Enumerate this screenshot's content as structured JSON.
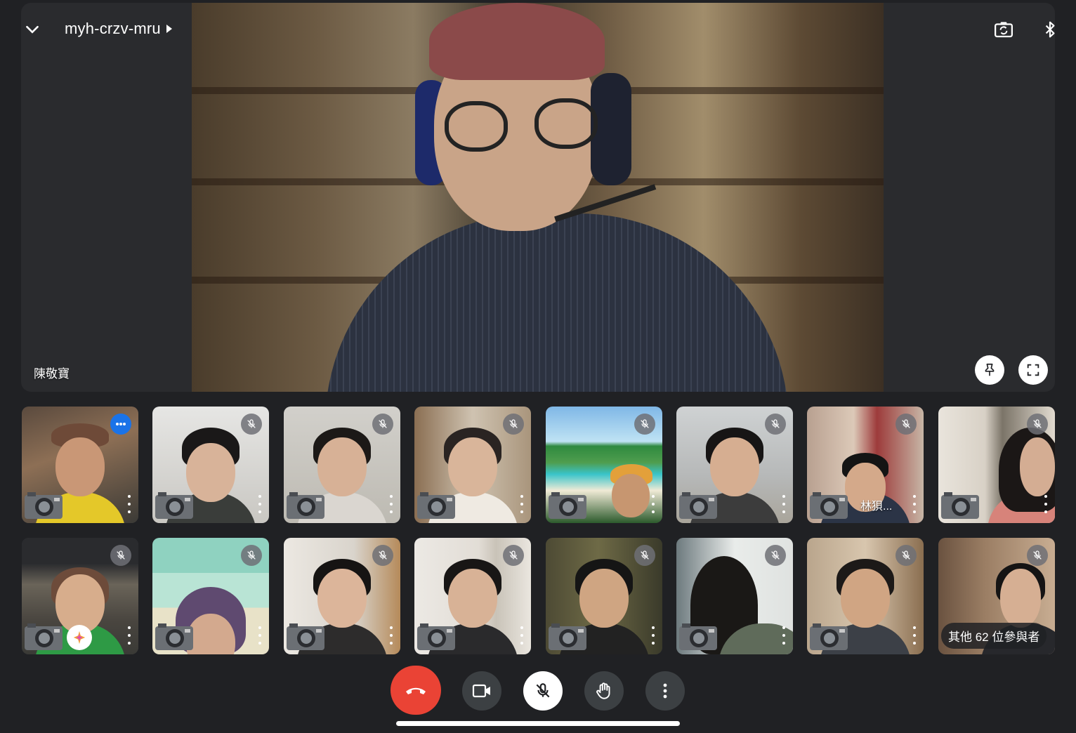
{
  "meeting": {
    "code": "myh-crzv-mru"
  },
  "main_speaker": {
    "name": "陳敬寶"
  },
  "participants_row1": [
    {
      "name": "",
      "status": "more"
    },
    {
      "name": "",
      "status": "muted"
    },
    {
      "name": "",
      "status": "muted"
    },
    {
      "name": "",
      "status": "muted"
    },
    {
      "name": "",
      "status": "muted"
    },
    {
      "name": "",
      "status": "muted"
    },
    {
      "name": "林狽...",
      "status": "muted"
    },
    {
      "name": "",
      "status": "muted"
    }
  ],
  "participants_row2": [
    {
      "name": "",
      "status": "muted"
    },
    {
      "name": "",
      "status": "muted"
    },
    {
      "name": "",
      "status": "muted"
    },
    {
      "name": "",
      "status": "muted"
    },
    {
      "name": "",
      "status": "muted"
    },
    {
      "name": "",
      "status": "muted"
    },
    {
      "name": "",
      "status": "muted"
    },
    {
      "name": "",
      "status": "muted"
    }
  ],
  "others_count_label": "其他 62 位參與者",
  "colors": {
    "end_call": "#ea4335",
    "dark_button": "#3c4043",
    "more_badge": "#1a73e8",
    "background": "#202124"
  },
  "icons": {
    "collapse": "chevron-down-icon",
    "switch_camera": "camera-flip-icon",
    "audio_output": "bluetooth-icon",
    "pin": "pin-icon",
    "fullscreen": "fullscreen-icon",
    "end_call": "phone-hangup-icon",
    "camera": "video-camera-icon",
    "mic": "mic-off-icon",
    "raise_hand": "hand-icon",
    "more": "more-vertical-icon"
  }
}
